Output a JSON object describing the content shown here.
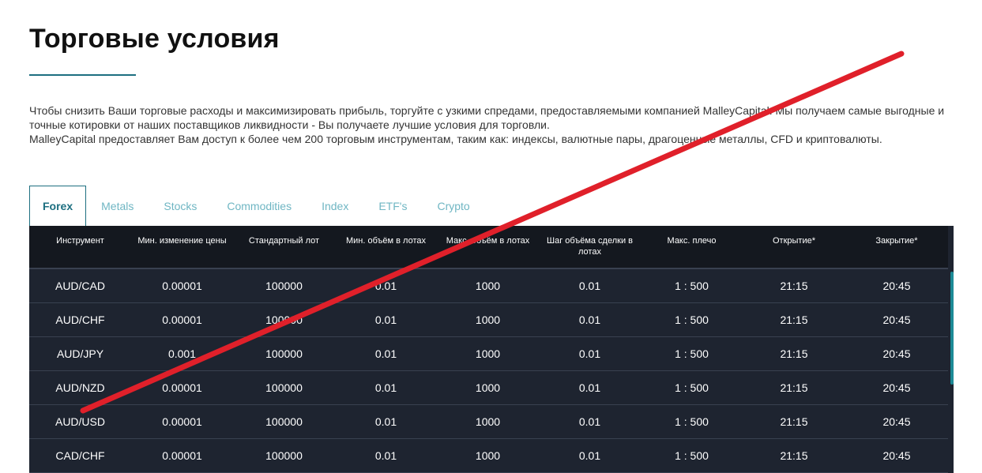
{
  "page": {
    "title": "Торговые условия",
    "intro_line1": "Чтобы снизить Ваши торговые расходы и максимизировать прибыль, торгуйте с узкими спредами, предоставляемыми компанией MalleyCapital. Мы получаем самые выгодные и точные котировки от наших поставщиков ликвидности - Вы получаете лучшие условия для торговли.",
    "intro_line2": "MalleyCapital предоставляет Вам доступ к более чем 200 торговым инструментам, таким как: индексы, валютные пары, драгоценные металлы, CFD и криптовалюты."
  },
  "tabs": [
    {
      "label": "Forex",
      "active": true
    },
    {
      "label": "Metals",
      "active": false
    },
    {
      "label": "Stocks",
      "active": false
    },
    {
      "label": "Commodities",
      "active": false
    },
    {
      "label": "Index",
      "active": false
    },
    {
      "label": "ETF's",
      "active": false
    },
    {
      "label": "Crypto",
      "active": false
    }
  ],
  "table": {
    "headers": [
      "Инструмент",
      "Мин. изменение цены",
      "Стандартный лот",
      "Мин. объём в лотах",
      "Макс. объём в лотах",
      "Шаг объёма сделки в лотах",
      "Макс. плечо",
      "Открытие*",
      "Закрытие*"
    ],
    "rows": [
      [
        "AUD/CAD",
        "0.00001",
        "100000",
        "0.01",
        "1000",
        "0.01",
        "1 : 500",
        "21:15",
        "20:45"
      ],
      [
        "AUD/CHF",
        "0.00001",
        "100000",
        "0.01",
        "1000",
        "0.01",
        "1 : 500",
        "21:15",
        "20:45"
      ],
      [
        "AUD/JPY",
        "0.001",
        "100000",
        "0.01",
        "1000",
        "0.01",
        "1 : 500",
        "21:15",
        "20:45"
      ],
      [
        "AUD/NZD",
        "0.00001",
        "100000",
        "0.01",
        "1000",
        "0.01",
        "1 : 500",
        "21:15",
        "20:45"
      ],
      [
        "AUD/USD",
        "0.00001",
        "100000",
        "0.01",
        "1000",
        "0.01",
        "1 : 500",
        "21:15",
        "20:45"
      ],
      [
        "CAD/CHF",
        "0.00001",
        "100000",
        "0.01",
        "1000",
        "0.01",
        "1 : 500",
        "21:15",
        "20:45"
      ]
    ]
  },
  "colors": {
    "accent": "#1d6f80",
    "tab_inactive": "#6fb6c3",
    "table_header_bg": "#14181f",
    "table_body_bg": "#1e2430",
    "strike_line": "#e0202a"
  }
}
